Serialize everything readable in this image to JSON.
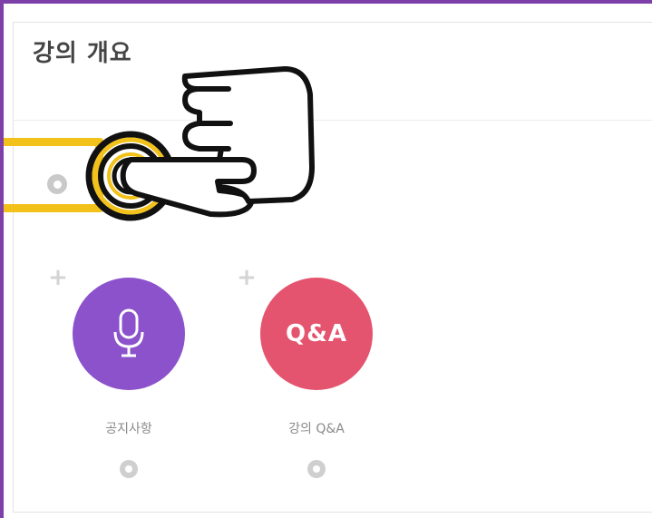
{
  "section": {
    "title": "강의 개요"
  },
  "modules": [
    {
      "label": "공지사항",
      "icon": "microphone-icon",
      "color": "#8b52cc"
    },
    {
      "label": "강의 Q&A",
      "icon_text": "Q&A",
      "color": "#e5546e"
    }
  ],
  "highlight_color": "#f2c21b",
  "frame_color": "#7d3fa8",
  "pointer": {
    "icon": "hand-pointer-icon"
  }
}
